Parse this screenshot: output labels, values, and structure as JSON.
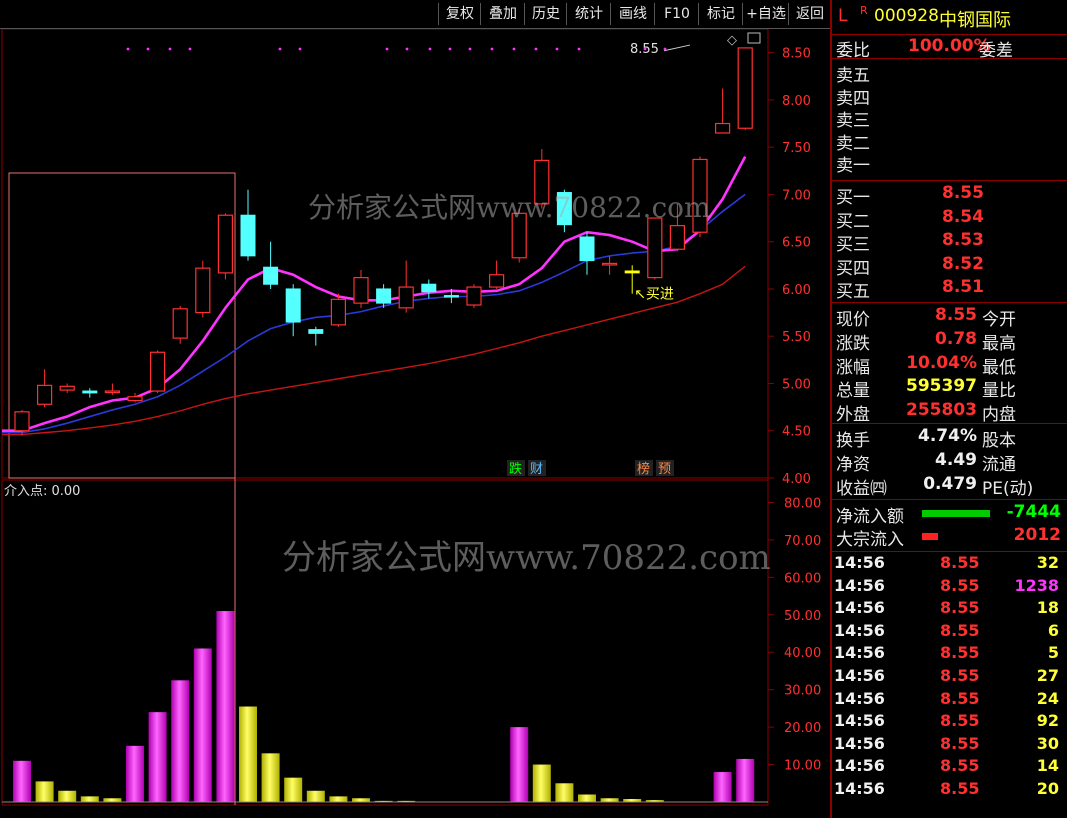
{
  "toolbar": {
    "buttons": [
      "复权",
      "叠加",
      "历史",
      "统计",
      "画线",
      "F10",
      "标记",
      "+自选",
      "返回"
    ]
  },
  "stock": {
    "prefix": "L",
    "flag": "R",
    "code": "000928",
    "name": "中钢国际"
  },
  "watermark": "分析家公式网www.70822.com",
  "main_chart": {
    "price_axis": [
      "8.50",
      "8.00",
      "7.50",
      "7.00",
      "6.50",
      "6.00",
      "5.50",
      "5.00",
      "4.50",
      "4.00"
    ],
    "last_price_tag": "8.55",
    "buy_signal_label": "买进",
    "badges": [
      "跌",
      "财",
      "榜",
      "预"
    ]
  },
  "indicator": {
    "title": "介入点: 0.00",
    "axis": [
      "80.00",
      "70.00",
      "60.00",
      "50.00",
      "40.00",
      "30.00",
      "20.00",
      "10.00"
    ]
  },
  "chart_data": {
    "type": "candlestick",
    "candles": [
      [
        4.5,
        4.7,
        4.45,
        4.72
      ],
      [
        4.78,
        4.98,
        4.75,
        5.15
      ],
      [
        4.93,
        4.97,
        4.9,
        5.0
      ],
      [
        4.92,
        4.9,
        4.85,
        4.95
      ],
      [
        4.92,
        4.92,
        4.88,
        5.0
      ],
      [
        4.82,
        4.86,
        4.8,
        4.9
      ],
      [
        4.92,
        5.33,
        4.9,
        5.35
      ],
      [
        5.48,
        5.79,
        5.42,
        5.82
      ],
      [
        5.75,
        6.22,
        5.7,
        6.3
      ],
      [
        6.17,
        6.78,
        6.1,
        6.8
      ],
      [
        6.78,
        6.35,
        6.3,
        7.05
      ],
      [
        6.23,
        6.05,
        6.0,
        6.5
      ],
      [
        6.0,
        5.65,
        5.5,
        6.05
      ],
      [
        5.57,
        5.53,
        5.4,
        5.6
      ],
      [
        5.62,
        5.89,
        5.6,
        5.95
      ],
      [
        5.85,
        6.12,
        5.8,
        6.2
      ],
      [
        6.0,
        5.85,
        5.8,
        6.05
      ],
      [
        5.8,
        6.02,
        5.75,
        6.3
      ],
      [
        6.05,
        5.97,
        5.9,
        6.1
      ],
      [
        5.93,
        5.92,
        5.85,
        6.0
      ],
      [
        5.83,
        6.02,
        5.8,
        6.05
      ],
      [
        6.02,
        6.15,
        6.0,
        6.3
      ],
      [
        6.33,
        6.8,
        6.28,
        6.85
      ],
      [
        6.9,
        7.36,
        6.85,
        7.48
      ],
      [
        7.02,
        6.68,
        6.6,
        7.05
      ],
      [
        6.55,
        6.3,
        6.15,
        6.6
      ],
      [
        6.27,
        6.27,
        6.15,
        6.35
      ],
      [
        6.19,
        6.17,
        5.95,
        6.25
      ],
      [
        6.12,
        6.75,
        6.1,
        6.75
      ],
      [
        6.42,
        6.67,
        6.4,
        6.9
      ],
      [
        6.6,
        7.37,
        6.55,
        7.4
      ],
      [
        7.65,
        7.75,
        7.65,
        8.12
      ],
      [
        7.7,
        8.55,
        7.68,
        8.55
      ]
    ],
    "ma_short": [
      4.5,
      4.58,
      4.65,
      4.75,
      4.82,
      4.85,
      4.95,
      5.15,
      5.45,
      5.8,
      6.1,
      6.22,
      6.15,
      6.02,
      5.92,
      5.88,
      5.88,
      5.92,
      5.96,
      5.98,
      5.97,
      5.98,
      6.05,
      6.22,
      6.5,
      6.6,
      6.57,
      6.5,
      6.4,
      6.42,
      6.62,
      6.95,
      7.4
    ],
    "ma_mid": [
      4.48,
      4.52,
      4.58,
      4.65,
      4.72,
      4.78,
      4.86,
      4.98,
      5.13,
      5.28,
      5.45,
      5.58,
      5.65,
      5.7,
      5.72,
      5.76,
      5.82,
      5.87,
      5.9,
      5.92,
      5.92,
      5.94,
      5.98,
      6.07,
      6.18,
      6.3,
      6.35,
      6.38,
      6.4,
      6.45,
      6.62,
      6.82,
      7.0
    ],
    "ma_long": [
      4.46,
      4.48,
      4.5,
      4.53,
      4.56,
      4.6,
      4.65,
      4.71,
      4.78,
      4.84,
      4.89,
      4.93,
      4.97,
      5.01,
      5.05,
      5.09,
      5.13,
      5.17,
      5.21,
      5.26,
      5.31,
      5.37,
      5.43,
      5.5,
      5.56,
      5.62,
      5.68,
      5.74,
      5.8,
      5.86,
      5.95,
      6.05,
      6.24
    ],
    "buy_signal_index": 27,
    "indicator_bars": [
      11,
      5.5,
      3,
      1.5,
      1,
      15,
      24,
      32.5,
      41,
      51,
      25.5,
      13,
      6.5,
      3,
      1.5,
      1,
      0.3,
      0.3,
      0,
      0,
      0,
      0,
      20,
      10,
      5,
      2,
      1,
      0.8,
      0.5,
      0,
      0,
      8,
      11.5
    ],
    "indicator_colors": [
      "mag",
      "yel",
      "yel",
      "yel",
      "yel",
      "mag",
      "mag",
      "mag",
      "mag",
      "mag",
      "yel",
      "yel",
      "yel",
      "yel",
      "yel",
      "yel",
      "yel",
      "yel",
      "yel",
      "yel",
      "yel",
      "yel",
      "mag",
      "yel",
      "yel",
      "yel",
      "yel",
      "yel",
      "yel",
      "yel",
      "yel",
      "mag",
      "mag"
    ],
    "price_ylim": [
      4.0,
      8.75
    ],
    "indicator_ylim": [
      0,
      86
    ]
  },
  "panel": {
    "ratio": {
      "label": "委比",
      "value": "100.00%",
      "diff_label": "委差"
    },
    "asks": [
      "卖五",
      "卖四",
      "卖三",
      "卖二",
      "卖一"
    ],
    "bids": [
      {
        "label": "买一",
        "price": "8.55"
      },
      {
        "label": "买二",
        "price": "8.54"
      },
      {
        "label": "买三",
        "price": "8.53"
      },
      {
        "label": "买四",
        "price": "8.52"
      },
      {
        "label": "买五",
        "price": "8.51"
      }
    ],
    "quote": [
      {
        "label": "现价",
        "value": "8.55",
        "cls": "red",
        "right": "今开"
      },
      {
        "label": "涨跌",
        "value": "0.78",
        "cls": "red",
        "right": "最高"
      },
      {
        "label": "涨幅",
        "value": "10.04%",
        "cls": "red",
        "right": "最低"
      },
      {
        "label": "总量",
        "value": "595397",
        "cls": "yel",
        "right": "量比"
      },
      {
        "label": "外盘",
        "value": "255803",
        "cls": "red",
        "right": "内盘"
      }
    ],
    "fund": [
      {
        "label": "换手",
        "value": "4.74%",
        "right": "股本"
      },
      {
        "label": "净资",
        "value": "4.49",
        "right": "流通"
      },
      {
        "label": "收益㈣",
        "value": "0.479",
        "right": "PE(动)"
      }
    ],
    "flow": [
      {
        "label": "净流入额",
        "value": "-7444",
        "cls": "grn",
        "bar": "#00cc00",
        "barw": 68
      },
      {
        "label": "大宗流入",
        "value": "2012",
        "cls": "red",
        "bar": "#ff2020",
        "barw": 16
      }
    ],
    "ticks": [
      {
        "time": "14:56",
        "price": "8.55",
        "vol": "32",
        "cls": "yel"
      },
      {
        "time": "14:56",
        "price": "8.55",
        "vol": "1238",
        "cls": "mag"
      },
      {
        "time": "14:56",
        "price": "8.55",
        "vol": "18",
        "cls": "yel"
      },
      {
        "time": "14:56",
        "price": "8.55",
        "vol": "6",
        "cls": "yel"
      },
      {
        "time": "14:56",
        "price": "8.55",
        "vol": "5",
        "cls": "yel"
      },
      {
        "time": "14:56",
        "price": "8.55",
        "vol": "27",
        "cls": "yel"
      },
      {
        "time": "14:56",
        "price": "8.55",
        "vol": "24",
        "cls": "yel"
      },
      {
        "time": "14:56",
        "price": "8.55",
        "vol": "92",
        "cls": "yel"
      },
      {
        "time": "14:56",
        "price": "8.55",
        "vol": "30",
        "cls": "yel"
      },
      {
        "time": "14:56",
        "price": "8.55",
        "vol": "14",
        "cls": "yel"
      },
      {
        "time": "14:56",
        "price": "8.55",
        "vol": "20",
        "cls": "yel"
      }
    ]
  }
}
